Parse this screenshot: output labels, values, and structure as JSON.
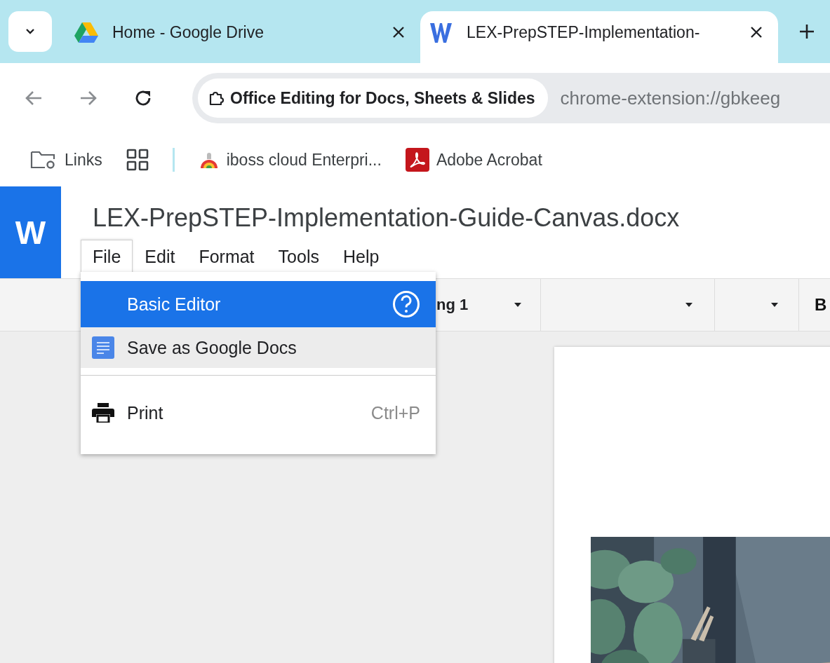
{
  "browser": {
    "tabs": [
      {
        "title": "Home - Google Drive",
        "kind": "drive",
        "selected": false
      },
      {
        "title": "LEX-PrepSTEP-Implementation-",
        "kind": "word",
        "selected": true
      }
    ],
    "extension_chip": "Office Editing for Docs, Sheets & Slides",
    "url": "chrome-extension://gbkeeg",
    "bookmarks": [
      {
        "label": "Links",
        "kind": "folder"
      },
      {
        "kind": "apps"
      },
      {
        "label": "iboss cloud Enterpri...",
        "kind": "iboss"
      },
      {
        "label": "Adobe Acrobat",
        "kind": "acrobat"
      }
    ]
  },
  "app": {
    "logo": "W",
    "document_title": "LEX-PrepSTEP-Implementation-Guide-Canvas.docx",
    "menu_bar": [
      {
        "label": "File",
        "selected": true
      },
      {
        "label": "Edit",
        "selected": false
      },
      {
        "label": "Format",
        "selected": false
      },
      {
        "label": "Tools",
        "selected": false
      },
      {
        "label": "Help",
        "selected": false
      }
    ],
    "toolbar": {
      "style_value": "ng 1",
      "bold": "B"
    },
    "file_menu": [
      {
        "kind": "help",
        "label": "Basic Editor",
        "selected": true,
        "hovered": false
      },
      {
        "kind": "docs",
        "label": "Save as Google Docs",
        "selected": false,
        "hovered": true
      },
      {
        "kind": "separator"
      },
      {
        "kind": "print",
        "label": "Print",
        "shortcut": "Ctrl+P",
        "selected": false,
        "hovered": false
      }
    ]
  }
}
